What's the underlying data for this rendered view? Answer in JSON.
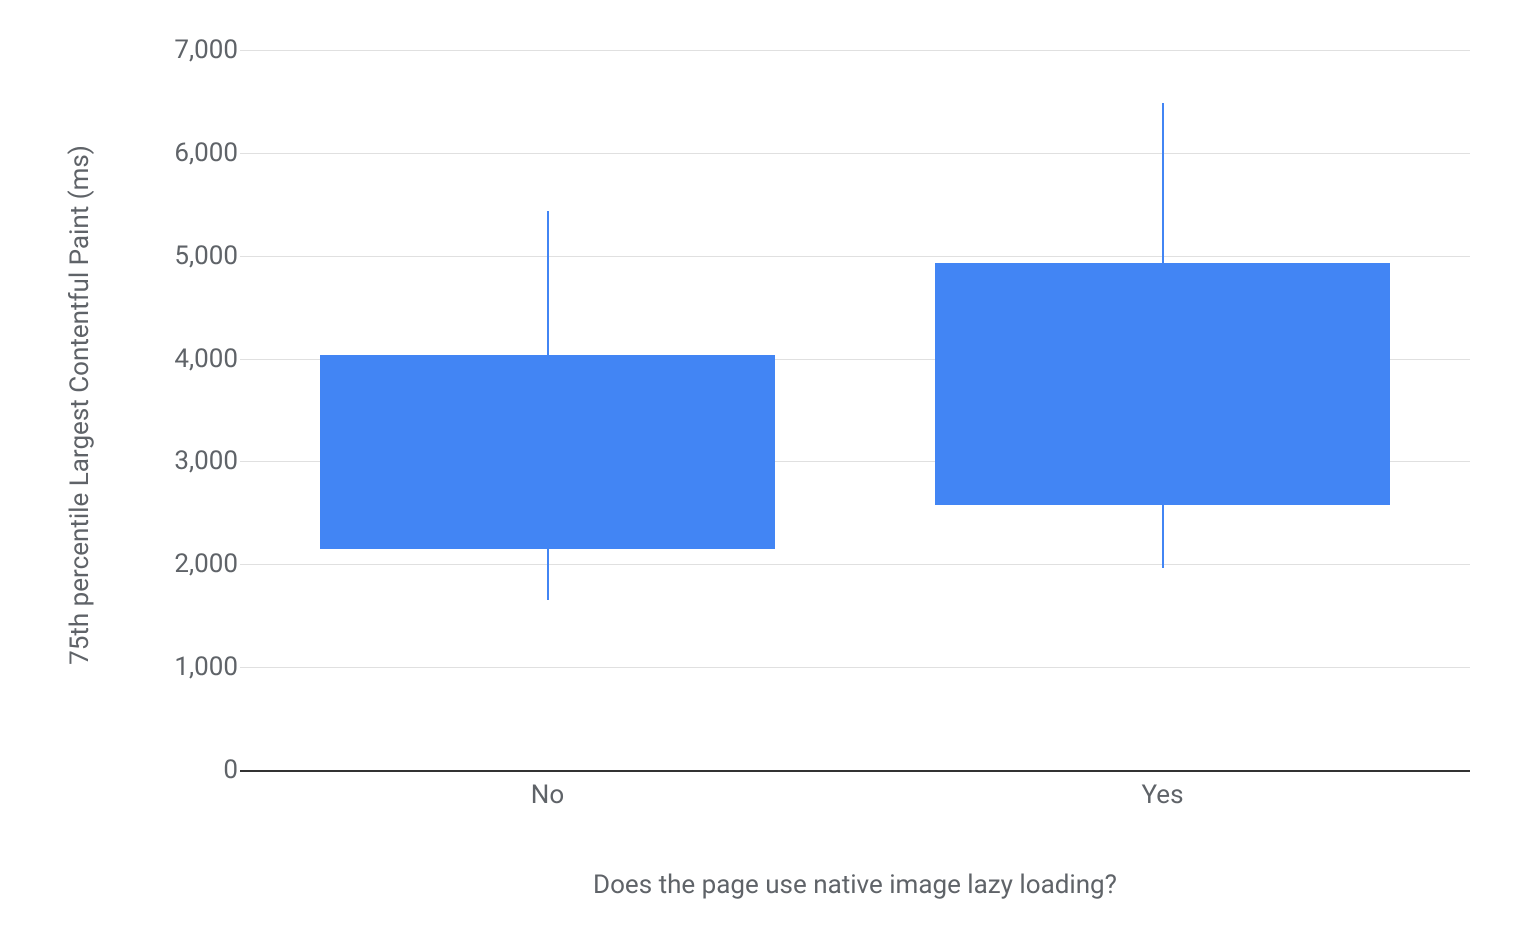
{
  "chart_data": {
    "type": "boxplot",
    "xlabel": "Does the page use native image lazy loading?",
    "ylabel": "75th percentile Largest Contentful Paint (ms)",
    "ylim": [
      0,
      7000
    ],
    "y_ticks": [
      0,
      1000,
      2000,
      3000,
      4000,
      5000,
      6000,
      7000
    ],
    "y_tick_labels": [
      "0",
      "1,000",
      "2,000",
      "3,000",
      "4,000",
      "5,000",
      "6,000",
      "7,000"
    ],
    "categories": [
      "No",
      "Yes"
    ],
    "series": [
      {
        "name": "No",
        "low": 1650,
        "q1": 2150,
        "median": null,
        "q3": 4030,
        "high": 5430
      },
      {
        "name": "Yes",
        "low": 1960,
        "q1": 2580,
        "median": null,
        "q3": 4930,
        "high": 6480
      }
    ],
    "box_color": "#4285f4"
  }
}
